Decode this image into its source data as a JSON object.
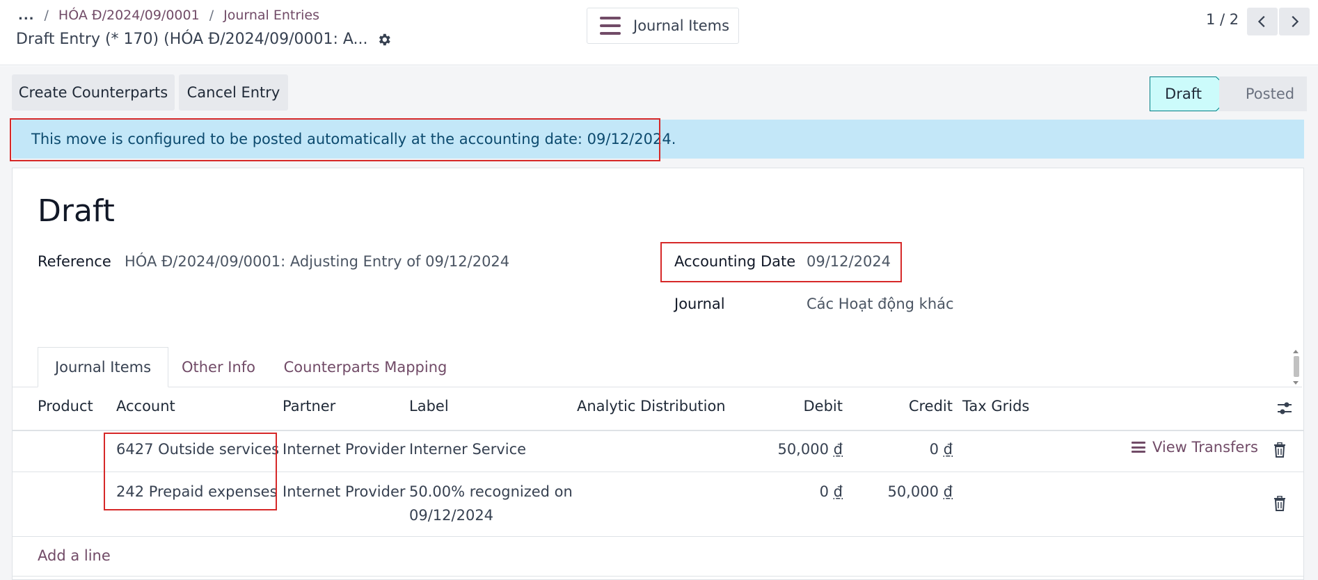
{
  "breadcrumb": {
    "dots": "...",
    "items": [
      "HÓA Đ/2024/09/0001",
      "Journal Entries"
    ]
  },
  "record_title": "Draft Entry (* 170) (HÓA Đ/2024/09/0001: A...",
  "smart_button": {
    "label": "Journal Items",
    "icon": "list-icon"
  },
  "pager": {
    "text": "1 / 2"
  },
  "actions": {
    "create": "Create Counterparts",
    "cancel": "Cancel Entry"
  },
  "statusbar": {
    "draft": "Draft",
    "posted": "Posted",
    "active": "Draft",
    "accent": "#017e84"
  },
  "alert": {
    "text": "This move is configured to be posted automatically at the accounting date: 09/12/2024."
  },
  "form": {
    "state": "Draft",
    "reference_label": "Reference",
    "reference_value": "HÓA Đ/2024/09/0001: Adjusting Entry of 09/12/2024",
    "date_label": "Accounting Date",
    "date_value": "09/12/2024",
    "journal_label": "Journal",
    "journal_value": "Các Hoạt động khác"
  },
  "tabs": [
    "Journal Items",
    "Other Info",
    "Counterparts Mapping"
  ],
  "table": {
    "headers": {
      "product": "Product",
      "account": "Account",
      "partner": "Partner",
      "label": "Label",
      "analytic": "Analytic Distribution",
      "debit": "Debit",
      "credit": "Credit",
      "tax": "Tax Grids"
    },
    "rows": [
      {
        "account": "6427 Outside services",
        "partner": "Internet Provider",
        "label": "Interner Service",
        "debit": "50,000",
        "credit": "0",
        "currency": "₫"
      },
      {
        "account": "242 Prepaid expenses",
        "partner": "Internet Provider",
        "label_line1": "50.00% recognized on",
        "label_line2": "09/12/2024",
        "debit": "0",
        "credit": "50,000",
        "currency": "₫"
      }
    ],
    "view_transfers": "View Transfers",
    "add_line": "Add a line"
  },
  "colors": {
    "brand": "#714B67",
    "highlight": "#d62828",
    "alert_bg": "#c3e7f8"
  }
}
